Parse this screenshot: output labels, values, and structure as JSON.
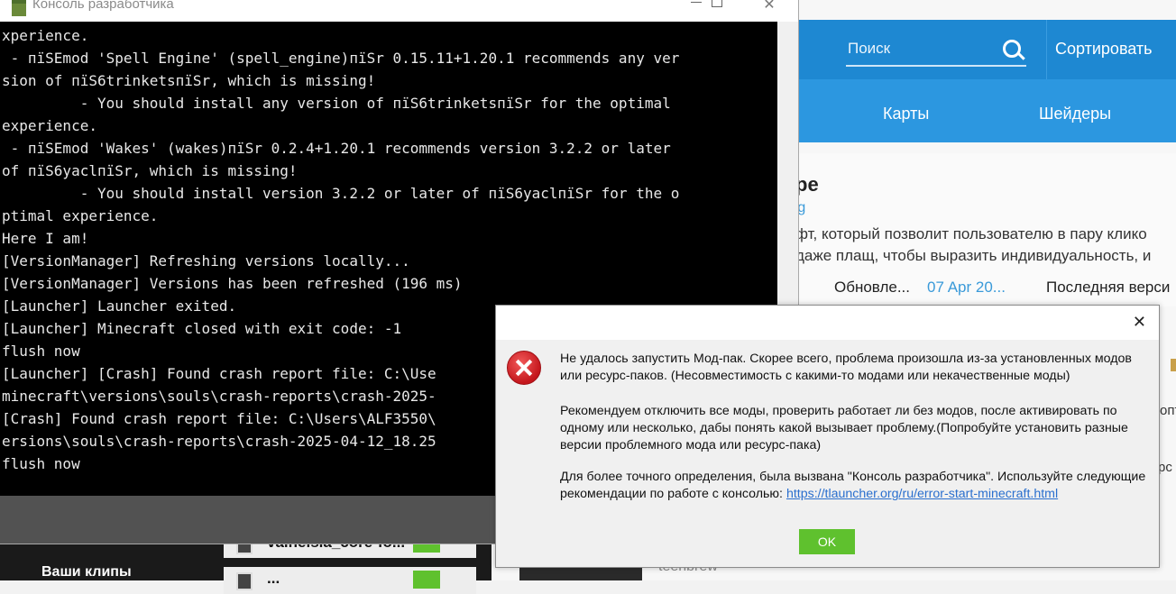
{
  "launcher": {
    "search_placeholder": "Поиск",
    "sort_label": "Сортировать",
    "tabs": [
      "Карты",
      "Шейдеры"
    ],
    "card": {
      "title": "ре",
      "link": "rg",
      "desc_line1": "фт, который позволит пользователю в пару клико",
      "desc_line2": "даже плащ, чтобы выразить индивидуальность, и",
      "updated_label": "Обновле...",
      "date": "07 Apr 20...",
      "last_version_label": "Последняя верси"
    },
    "edge_fragments": [
      "опт",
      "рс"
    ],
    "clips_label": "Ваши клипы",
    "mod_rows": [
      "valhelsia_core-fo...",
      "..."
    ],
    "clip_author": "teenbrew"
  },
  "console": {
    "title": "Консоль разработчика",
    "lines": [
      "xperience.",
      " - пїSEmod 'Spell Engine' (spell_engine)пїSr 0.15.11+1.20.1 recommends any ver",
      "sion of пїS6trinketsпїSr, which is missing!",
      "         - You should install any version of пїS6trinketsпїSr for the optimal",
      "experience.",
      " - пїSEmod 'Wakes' (wakes)пїSr 0.2.4+1.20.1 recommends version 3.2.2 or later",
      "of пїS6yaclпїSr, which is missing!",
      "         - You should install version 3.2.2 or later of пїS6yaclпїSr for the o",
      "ptimal experience.",
      "Here I am!",
      "[VersionManager] Refreshing versions locally...",
      "[VersionManager] Versions has been refreshed (196 ms)",
      "[Launcher] Launcher exited.",
      "[Launcher] Minecraft closed with exit code: -1",
      "flush now",
      "[Launcher] [Crash] Found crash report file: C:\\Use",
      "minecraft\\versions\\souls\\crash-reports\\crash-2025-",
      "[Crash] Found crash report file: C:\\Users\\ALF3550\\",
      "ersions\\souls\\crash-reports\\crash-2025-04-12_18.25",
      "flush now"
    ]
  },
  "dialog": {
    "p1": "Не удалось запустить Мод-пак. Скорее всего, проблема произошла из-за установленных модов или ресурс-паков. (Несовместимость с какими-то модами или некачественные моды)",
    "p2": "Рекомендуем отключить все моды, проверить работает ли без модов, после активировать по одному или несколько, дабы понять какой вызывает проблему.(Попробуйте установить разные версии проблемного мода или ресурс-пака)",
    "p3_text": "Для более точного определения, была вызвана \"Консоль разработчика\". Используйте следующие рекомендации по работе с консолью: ",
    "p3_link": "https://tlauncher.org/ru/error-start-minecraft.html",
    "ok_label": "OK",
    "close_glyph": "✕"
  },
  "colors": {
    "accent_blue": "#1e88d2",
    "ok_green": "#5fc12e",
    "link_blue": "#2a6fce",
    "error_red": "#c4161c"
  }
}
